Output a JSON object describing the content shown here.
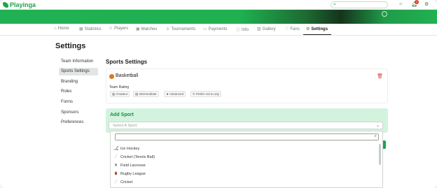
{
  "app": {
    "brand": "Playinga"
  },
  "topbar": {
    "search_icon": "search-icon",
    "icons": [
      "sun-icon",
      "bell-icon",
      "settings-icon"
    ],
    "notification_count": "1"
  },
  "nav": {
    "tabs": [
      {
        "label": "Home",
        "icon": "home-icon"
      },
      {
        "label": "Statistics",
        "icon": "stats-icon"
      },
      {
        "label": "Players",
        "icon": "players-icon"
      },
      {
        "label": "Matches",
        "icon": "matches-icon"
      },
      {
        "label": "Tournaments",
        "icon": "trophy-icon"
      },
      {
        "label": "Payments",
        "icon": "payment-icon"
      },
      {
        "label": "Info",
        "icon": "info-icon"
      },
      {
        "label": "Gallery",
        "icon": "gallery-icon"
      },
      {
        "label": "Fans",
        "icon": "fans-icon"
      },
      {
        "label": "Settings",
        "icon": "gear-icon"
      }
    ],
    "active": "Settings"
  },
  "page": {
    "title": "Settings"
  },
  "sidebar": {
    "items": [
      {
        "label": "Team Information"
      },
      {
        "label": "Sports Settings"
      },
      {
        "label": "Branding"
      },
      {
        "label": "Roles"
      },
      {
        "label": "Forms"
      },
      {
        "label": "Sponsors"
      },
      {
        "label": "Preferences"
      }
    ],
    "active": "Sports Settings"
  },
  "main": {
    "section_title": "Sports Settings",
    "sport_card": {
      "sport": "Basketball",
      "team_rating_label": "Team Rating",
      "ratings": [
        "Amateur",
        "Intermediate",
        "Advanced",
        "Prefer not to say"
      ]
    },
    "add_sport": {
      "title": "Add Sport",
      "placeholder": "Select A Sport"
    },
    "dropdown": {
      "options": [
        {
          "label": "Ice Hockey",
          "icon": "hockey-icon"
        },
        {
          "label": "Cricket (Tennis Ball)",
          "icon": "cricket-bat-icon"
        },
        {
          "label": "Field Lacrosse",
          "icon": "lacrosse-icon"
        },
        {
          "label": "Rugby League",
          "icon": "rugby-ball-icon"
        },
        {
          "label": "Cricket",
          "icon": "cricket-bat-icon"
        }
      ]
    }
  },
  "colors": {
    "brand_green": "#1fa34a",
    "add_card_bg": "#d3f3df",
    "delete_red": "#e23a2d"
  }
}
